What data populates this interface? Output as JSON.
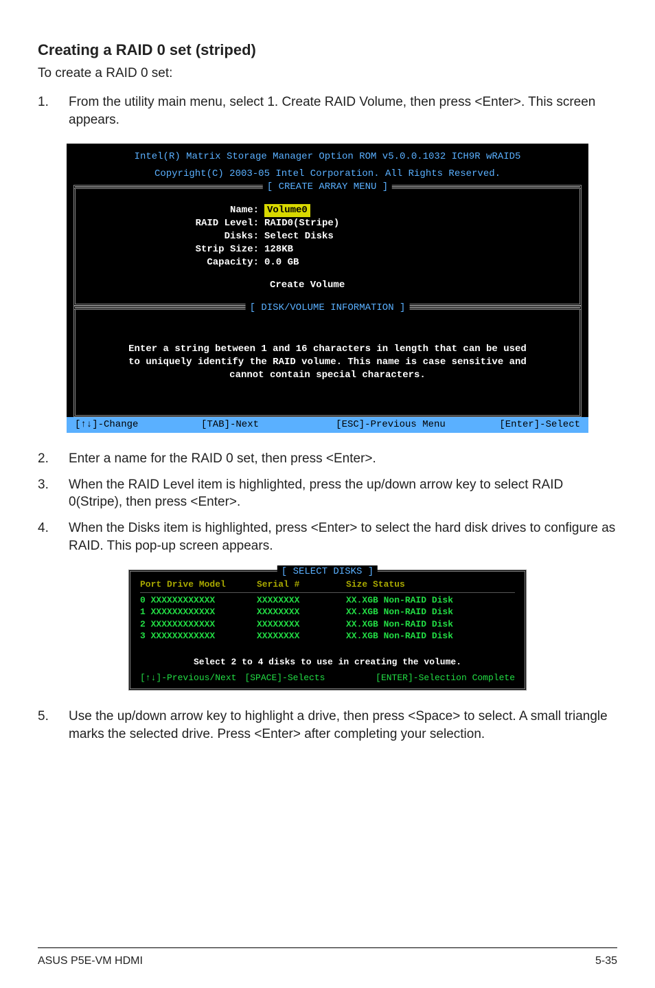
{
  "heading": "Creating a RAID 0 set (striped)",
  "intro": "To create a RAID 0 set:",
  "steps": {
    "s1_num": "1.",
    "s1_body": "From the utility main menu, select 1. Create RAID Volume, then press <Enter>. This screen appears.",
    "s2_num": "2.",
    "s2_body": "Enter a name for the RAID 0 set, then press <Enter>.",
    "s3_num": "3.",
    "s3_body": "When the RAID Level item is highlighted, press the up/down arrow key to select RAID 0(Stripe), then press <Enter>.",
    "s4_num": "4.",
    "s4_body": "When the Disks item is highlighted, press <Enter> to select the hard disk drives to configure as RAID. This pop-up screen appears.",
    "s5_num": "5.",
    "s5_body": "Use the up/down arrow key to highlight a drive, then press <Space>  to select. A small triangle marks the selected drive. Press <Enter> after completing your selection."
  },
  "term1": {
    "title1": "Intel(R) Matrix Storage Manager Option ROM v5.0.0.1032 ICH9R wRAID5",
    "title2": "Copyright(C) 2003-05 Intel Corporation. All Rights Reserved.",
    "banner1": "[ CREATE ARRAY MENU ]",
    "fields": {
      "name_k": "Name:",
      "name_v": "Volume0",
      "raid_k": "RAID Level:",
      "raid_v": "RAID0(Stripe)",
      "disks_k": "Disks:",
      "disks_v": "Select Disks",
      "strip_k": "Strip Size:",
      "strip_v": "128KB",
      "cap_k": "Capacity:",
      "cap_v": "0.0   GB"
    },
    "create": "Create Volume",
    "banner2": "[ DISK/VOLUME INFORMATION ]",
    "info1": "Enter a string between 1 and 16 characters in length that can be used",
    "info2": "to uniquely identify the RAID volume. This name is case sensitive and",
    "info3": "cannot contain special characters.",
    "footer": {
      "a": "[↑↓]-Change",
      "b": "[TAB]-Next",
      "c": "[ESC]-Previous Menu",
      "d": "[Enter]-Select"
    }
  },
  "term2": {
    "title": "[ SELECT DISKS ]",
    "head": {
      "c1": "Port Drive Model",
      "c2": "Serial #",
      "c3": "Size Status"
    },
    "rows": [
      {
        "c1": "0 XXXXXXXXXXXX",
        "c2": "XXXXXXXX",
        "c3": "XX.XGB Non-RAID Disk"
      },
      {
        "c1": "1 XXXXXXXXXXXX",
        "c2": "XXXXXXXX",
        "c3": "XX.XGB Non-RAID Disk"
      },
      {
        "c1": "2 XXXXXXXXXXXX",
        "c2": "XXXXXXXX",
        "c3": "XX.XGB Non-RAID Disk"
      },
      {
        "c1": "3 XXXXXXXXXXXX",
        "c2": "XXXXXXXX",
        "c3": "XX.XGB Non-RAID Disk"
      }
    ],
    "msg": "Select 2 to 4 disks to use in creating the volume.",
    "foot": {
      "a": "[↑↓]-Previous/Next",
      "b": "[SPACE]-Selects",
      "c": "[ENTER]-Selection Complete"
    }
  },
  "footer": {
    "left": "ASUS P5E-VM HDMI",
    "right": "5-35"
  }
}
